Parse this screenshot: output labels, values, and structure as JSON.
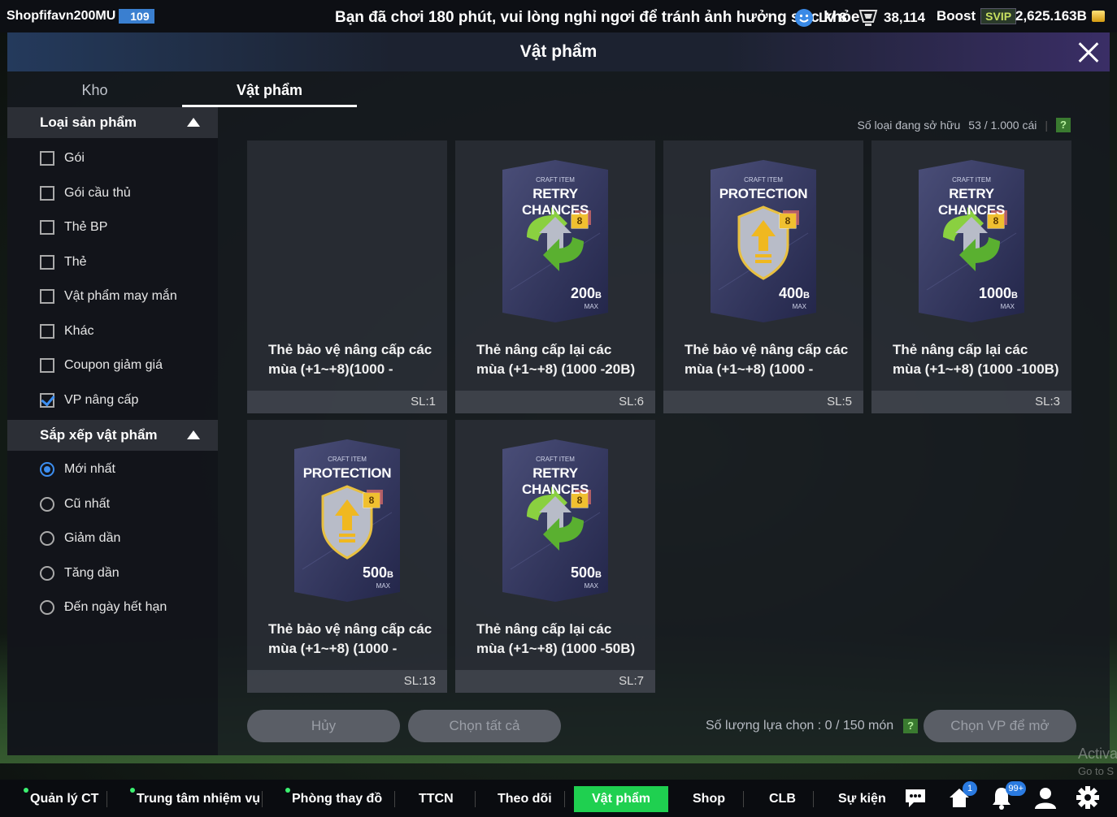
{
  "topbar": {
    "shop_name": "Shopfifavn200MU",
    "level_badge": "109",
    "notice": "Bạn đã chơi 180 phút, vui lòng nghỉ ngơi để tránh ảnh hưởng sức khỏe",
    "level": "LV 8",
    "points": "38,114",
    "boost_label": "Boost",
    "svip_label": "SVIP",
    "currency": "2,625.163B"
  },
  "header": {
    "title": "Vật phẩm"
  },
  "tabs": [
    {
      "label": "Kho"
    },
    {
      "label": "Vật phẩm"
    }
  ],
  "filters": {
    "category_title": "Loại sản phẩm",
    "categories": [
      {
        "label": "Gói",
        "checked": false
      },
      {
        "label": "Gói cầu thủ",
        "checked": false
      },
      {
        "label": "Thẻ BP",
        "checked": false
      },
      {
        "label": "Thẻ",
        "checked": false
      },
      {
        "label": "Vật phẩm may mắn",
        "checked": false
      },
      {
        "label": "Khác",
        "checked": false
      },
      {
        "label": "Coupon giảm giá",
        "checked": false
      },
      {
        "label": "VP nâng cấp",
        "checked": true
      }
    ],
    "sort_title": "Sắp xếp vật phẩm",
    "sorts": [
      {
        "label": "Mới nhất",
        "selected": true
      },
      {
        "label": "Cũ nhất",
        "selected": false
      },
      {
        "label": "Giảm dần",
        "selected": false
      },
      {
        "label": "Tăng dần",
        "selected": false
      },
      {
        "label": "Đến ngày hết hạn",
        "selected": false
      }
    ]
  },
  "owned": {
    "label": "Số loại đang sở hữu",
    "value": "53 / 1.000 cái",
    "help": "?"
  },
  "items": [
    {
      "type": "none",
      "name": "Thẻ bảo vệ nâng cấp các mùa (+1~+8)(1000 -",
      "qty": "SL:1"
    },
    {
      "type": "retry",
      "card_sub": "CRAFT ITEM",
      "card_title": "RETRY CHANCES",
      "card_value": "200",
      "name": "Thẻ nâng cấp lại các mùa (+1~+8) (1000 -20B)",
      "qty": "SL:6"
    },
    {
      "type": "protect",
      "card_sub": "CRAFT ITEM",
      "card_title": "PROTECTION",
      "card_value": "400",
      "name": "Thẻ bảo vệ nâng cấp các mùa (+1~+8) (1000 -",
      "qty": "SL:5"
    },
    {
      "type": "retry",
      "card_sub": "CRAFT ITEM",
      "card_title": "RETRY CHANCES",
      "card_value": "1000",
      "name": "Thẻ nâng cấp lại các mùa (+1~+8) (1000 -100B)",
      "qty": "SL:3"
    },
    {
      "type": "protect",
      "card_sub": "CRAFT ITEM",
      "card_title": "PROTECTION",
      "card_value": "500",
      "name": "Thẻ bảo vệ nâng cấp các mùa (+1~+8) (1000 -",
      "qty": "SL:13"
    },
    {
      "type": "retry",
      "card_sub": "CRAFT ITEM",
      "card_title": "RETRY CHANCES",
      "card_value": "500",
      "name": "Thẻ nâng cấp lại các mùa (+1~+8) (1000 -50B)",
      "qty": "SL:7"
    }
  ],
  "card_badge": "8",
  "card_unit": "B",
  "card_max": "MAX",
  "actions": {
    "cancel": "Hủy",
    "select_all": "Chọn tất cả",
    "selection_label": "Số lượng lựa chọn : 0 / 150 món",
    "open": "Chọn VP để mở"
  },
  "bottomnav": [
    {
      "label": "Quản lý CT"
    },
    {
      "label": "Trung tâm nhiệm vụ"
    },
    {
      "label": "Phòng thay đồ"
    },
    {
      "label": "TTCN"
    },
    {
      "label": "Theo dõi"
    },
    {
      "label": "Vật phẩm"
    },
    {
      "label": "Shop"
    },
    {
      "label": "CLB"
    },
    {
      "label": "Sự kiện"
    }
  ],
  "badges": {
    "home": "1",
    "notifications": "99+"
  },
  "watermark": {
    "line1": "Activa",
    "line2": "Go to S"
  },
  "colors": {
    "active_nav": "#1fd050",
    "accent_blue": "#3c8ef0",
    "help_green": "#3a7a30"
  }
}
